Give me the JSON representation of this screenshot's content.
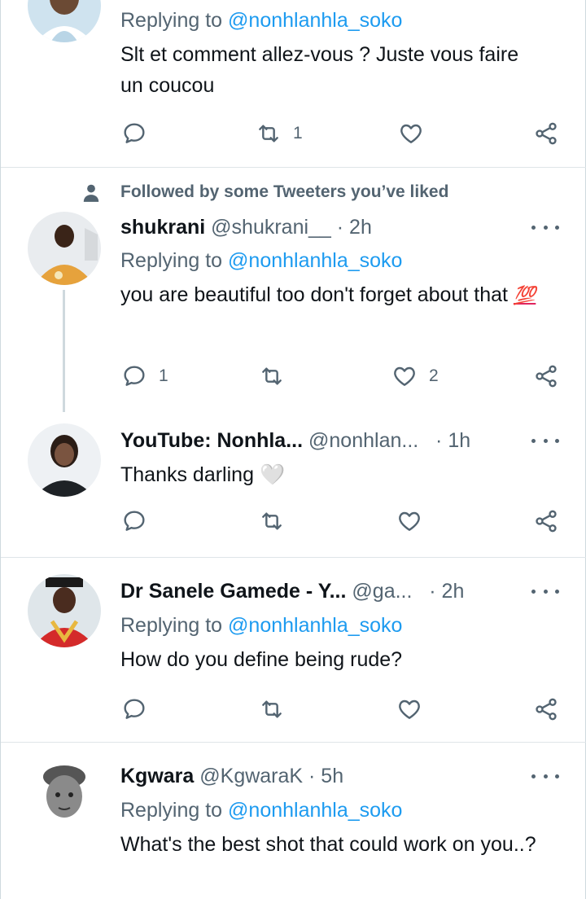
{
  "tweets": [
    {
      "reply_prefix": "Replying to",
      "reply_handle": "@nonhlanhla_soko",
      "text": "Slt et comment allez-vous ? Juste vous faire un coucou",
      "replies": "",
      "retweets": "1",
      "likes": ""
    },
    {
      "followed_by": "Followed by some Tweeters you’ve liked",
      "name": "shukrani",
      "meta": "@shukrani__ · 2h",
      "reply_prefix": "Replying to",
      "reply_handle": "@nonhlanhla_soko",
      "text": "you are beautiful too don't forget about that",
      "emoji": "💯",
      "replies": "1",
      "retweets": "",
      "likes": "2"
    },
    {
      "name": "YouTube: Nonhla...",
      "meta": "@nonhlan...   · 1h",
      "text": "Thanks darling",
      "emoji": "🤍",
      "replies": "",
      "retweets": "",
      "likes": ""
    },
    {
      "name": "Dr Sanele Gamede - Y...",
      "meta": "@ga...   · 2h",
      "reply_prefix": "Replying to",
      "reply_handle": "@nonhlanhla_soko",
      "text": "How do you define being rude?",
      "replies": "",
      "retweets": "",
      "likes": ""
    },
    {
      "name": "Kgwara",
      "meta": "@KgwaraK · 5h",
      "reply_prefix": "Replying to",
      "reply_handle": "@nonhlanhla_soko",
      "text": "What's the best shot that could work on you..?"
    }
  ],
  "colors": {
    "accent": "#1d9bf0",
    "secondary_text": "#536471",
    "primary_text": "#0f1419",
    "divider": "#dfe5e8"
  },
  "icons": [
    "reply-icon",
    "retweet-icon",
    "like-icon",
    "share-icon",
    "more-icon",
    "person-icon"
  ]
}
